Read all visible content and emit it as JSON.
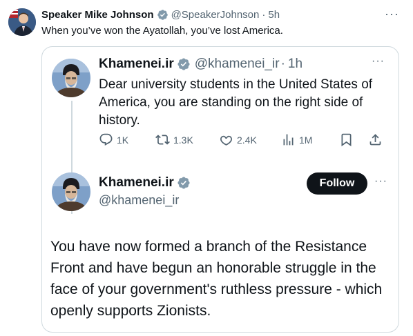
{
  "outer": {
    "name": "Speaker Mike Johnson",
    "handle": "@SpeakerJohnson",
    "separator": "·",
    "time": "5h",
    "text": "When you’ve won the Ayatollah, you’ve lost America.",
    "more": "···"
  },
  "quote1": {
    "name": "Khamenei.ir",
    "handle": "@khamenei_ir",
    "separator": "·",
    "time": "1h",
    "text": "Dear university students in the United States of America, you are standing on the right side of history.",
    "more": "···",
    "actions": {
      "replies": "1K",
      "retweets": "1.3K",
      "likes": "2.4K",
      "views": "1M"
    }
  },
  "quote2": {
    "name": "Khamenei.ir",
    "handle": "@khamenei_ir",
    "follow_label": "Follow",
    "more": "···",
    "text": "You have now formed a branch of the Resistance Front and have begun an honorable struggle in the face of your government's ruthless pressure - which openly supports Zionists."
  },
  "colors": {
    "text": "#0f1419",
    "secondary": "#536471",
    "verified": "#829aab",
    "border": "#cfd9de"
  },
  "icons": [
    "verified-badge-icon",
    "reply-icon",
    "retweet-icon",
    "like-icon",
    "views-icon",
    "bookmark-icon",
    "share-icon",
    "more-icon"
  ]
}
